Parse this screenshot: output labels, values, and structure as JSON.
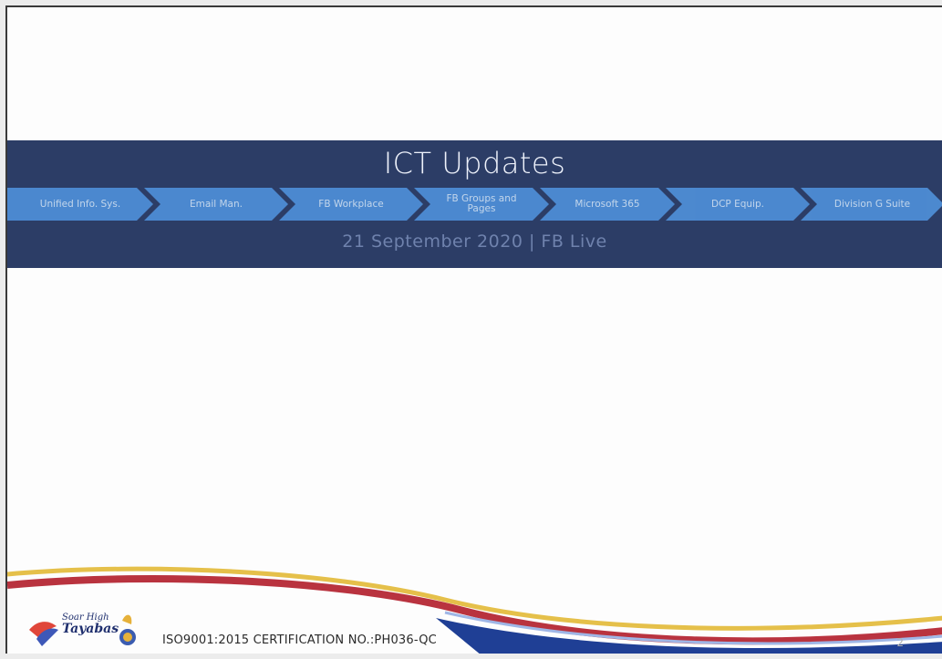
{
  "slide": {
    "title": "ICT Updates",
    "subtitle": "21 September 2020 | FB Live",
    "steps": [
      {
        "label": "Unified Info. Sys."
      },
      {
        "label": "Email Man."
      },
      {
        "label": "FB Workplace"
      },
      {
        "label": "FB Groups and Pages"
      },
      {
        "label": "Microsoft 365"
      },
      {
        "label": "DCP Equip."
      },
      {
        "label": "Division G Suite"
      }
    ],
    "footer": {
      "logo_text_line1": "Soar High",
      "logo_text_line2": "Tayabas",
      "certification": "ISO9001:2015 CERTIFICATION NO.:PH036-QC",
      "page_number": "2"
    }
  },
  "colors": {
    "banner": "#2c3d66",
    "chevron": "#4f8fd8",
    "swoosh_yellow": "#e5c04a",
    "swoosh_red": "#b9333f",
    "swoosh_blue": "#1f3f95"
  }
}
